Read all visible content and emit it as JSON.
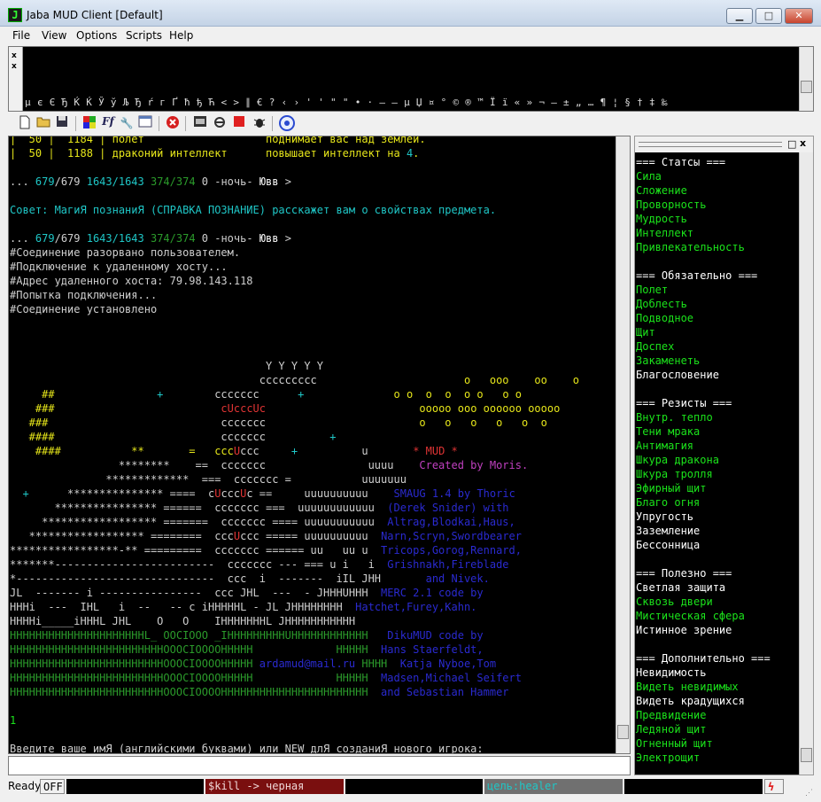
{
  "window": {
    "title": "Jaba MUD Client [Default]",
    "app_icon": "J",
    "minimize": "▁",
    "maximize": "□",
    "close": "✕"
  },
  "menu": [
    "File",
    "View",
    "Options",
    "Scripts",
    "Help"
  ],
  "char_panel": {
    "chars": "µ є Є Ђ Ќ Ќ Ў ў Љ Ђ ŕ г Ґ ħ ђ Ћ < > ∥ € ? ‹ › ' ' \" \" • · – — µ Џ ¤ ° © ® ™ Ї ї « » ¬ – ± „ … ¶ ¦ § † ‡ ‰",
    "gutter_top": "x",
    "gutter_bottom": "x"
  },
  "toolbar": {
    "icons": [
      "new-file-icon",
      "open-folder-icon",
      "save-icon",
      "color-palette-icon",
      "font-icon",
      "wrench-icon",
      "window-icon",
      "stop-record-icon",
      "map-icon",
      "disconnect-icon",
      "stop-icon",
      "bug-icon",
      "connect-icon"
    ]
  },
  "terminal": {
    "lines": [
      [
        [
          "|  50 |  1184 | полет                   поднимает вас над землей.",
          "y"
        ]
      ],
      [
        [
          "|  50 |  1188 | драконий интеллект      повышает интеллект на ",
          "y"
        ],
        [
          "4",
          "c"
        ],
        [
          ".",
          "y"
        ]
      ],
      [
        [
          "",
          "w"
        ]
      ],
      [
        [
          "... ",
          "w"
        ],
        [
          "679",
          "c"
        ],
        [
          "/679 ",
          "w"
        ],
        [
          "1643/1643",
          "c"
        ],
        [
          " ",
          "w"
        ],
        [
          "374/374",
          "dg"
        ],
        [
          " 0 -ночь- ",
          "w"
        ],
        [
          "Ювв",
          "bw"
        ],
        [
          " >",
          "w"
        ]
      ],
      [
        [
          "",
          "w"
        ]
      ],
      [
        [
          "Совет: МагиЯ познаниЯ (СПРАВКА ПОЗНАНИЕ) расскажет вам о свойствах предмета.",
          "c"
        ]
      ],
      [
        [
          "",
          "w"
        ]
      ],
      [
        [
          "... ",
          "w"
        ],
        [
          "679",
          "c"
        ],
        [
          "/679 ",
          "w"
        ],
        [
          "1643/1643",
          "c"
        ],
        [
          " ",
          "w"
        ],
        [
          "374/374",
          "dg"
        ],
        [
          " 0 -ночь- ",
          "w"
        ],
        [
          "Ювв",
          "bw"
        ],
        [
          " >",
          "w"
        ]
      ],
      [
        [
          "#Соединение разорвано пользователем.",
          "w"
        ]
      ],
      [
        [
          "#Подключение к удаленному хосту...",
          "w"
        ]
      ],
      [
        [
          "#Адрес удаленного хоста: 79.98.143.118",
          "w"
        ]
      ],
      [
        [
          "#Попытка подключения...",
          "w"
        ]
      ],
      [
        [
          "#Соединение установлено",
          "w"
        ]
      ],
      [
        [
          "",
          "w"
        ]
      ],
      [
        [
          "",
          "w"
        ]
      ],
      [
        [
          "",
          "w"
        ]
      ],
      [
        [
          "                                        Y Y Y Y Y",
          "w"
        ]
      ],
      [
        [
          "                                       ccccccccc                       ",
          "w"
        ],
        [
          "o   ooo    oo    o",
          "y"
        ]
      ],
      [
        [
          "     ##                ",
          "y"
        ],
        [
          "+",
          "c"
        ],
        [
          "        ccccccc      ",
          "w"
        ],
        [
          "+",
          "c"
        ],
        [
          "              ",
          "w"
        ],
        [
          "o o  o  o  o o   o o",
          "y"
        ]
      ],
      [
        [
          "    ###                          ",
          "y"
        ],
        [
          "cUcccUc",
          "r"
        ],
        [
          "                        ",
          "w"
        ],
        [
          "ooooo ooo oooooo ooooo",
          "y"
        ]
      ],
      [
        [
          "   ###                           ",
          "y"
        ],
        [
          "ccccccc",
          "w"
        ],
        [
          "                        ",
          "w"
        ],
        [
          "o   o   o   o   o  o",
          "y"
        ]
      ],
      [
        [
          "   ####                          ",
          "y"
        ],
        [
          "ccccccc",
          "w"
        ],
        [
          "          ",
          "w"
        ],
        [
          "+",
          "c"
        ]
      ],
      [
        [
          "    ####           **       =   ccc",
          "y"
        ],
        [
          "U",
          "r"
        ],
        [
          "ccc     ",
          "w"
        ],
        [
          "+",
          "c"
        ],
        [
          "          u       ",
          "w"
        ],
        [
          "* MUD *",
          "r"
        ]
      ],
      [
        [
          "                 ********    ==  ccccccc                uuuu    ",
          "w"
        ],
        [
          "Created by Moris.",
          "m"
        ]
      ],
      [
        [
          "               *************  ===  ccccccc =           uuuuuuu",
          "w"
        ]
      ],
      [
        [
          "  ",
          "w"
        ],
        [
          "+",
          "c"
        ],
        [
          "      *************** ====  c",
          "w"
        ],
        [
          "U",
          "r"
        ],
        [
          "ccc",
          "w"
        ],
        [
          "U",
          "r"
        ],
        [
          "c ==     uuuuuuuuuu    ",
          "w"
        ],
        [
          "SMAUG 1.4 by Thoric",
          "db"
        ]
      ],
      [
        [
          "       **************** ======  ccccccc ===  uuuuuuuuuuuu  ",
          "w"
        ],
        [
          "(Derek Snider) with",
          "db"
        ]
      ],
      [
        [
          "     ****************** =======  ccccccc ==== uuuuuuuuuuu  ",
          "w"
        ],
        [
          "Altrag,Blodkai,Haus,",
          "db"
        ]
      ],
      [
        [
          "   ****************** ========  ccc",
          "w"
        ],
        [
          "U",
          "r"
        ],
        [
          "ccc ===== uuuuuuuuuu  ",
          "w"
        ],
        [
          "Narn,Scryn,Swordbearer",
          "db"
        ]
      ],
      [
        [
          "*****************-** =========  ccccccc ====== uu   uu u  ",
          "w"
        ],
        [
          "Tricops,Gorog,Rennard,",
          "db"
        ]
      ],
      [
        [
          "*******-------------------------  ccccccc --- === u i   i  ",
          "w"
        ],
        [
          "Grishnakh,Fireblade",
          "db"
        ]
      ],
      [
        [
          "*-------------------------------  ccc  i  -------  iIL JHH       ",
          "w"
        ],
        [
          "and Nivek.",
          "db"
        ]
      ],
      [
        [
          "JL  ------- i ----------------  ccc JHL  ---  - JHHHUHHH  ",
          "w"
        ],
        [
          "MERC 2.1 code by",
          "db"
        ]
      ],
      [
        [
          "HHHi  ---  IHL   i  --   -- c iHHHHHL - JL JHHHHHHHH  ",
          "w"
        ],
        [
          "Hatchet,Furey,Kahn.",
          "db"
        ]
      ],
      [
        [
          "HHHHi_____iHHHL JHL    O   O    IHHHHHHHL JHHHHHHHHHHH",
          "w"
        ]
      ],
      [
        [
          "HHHHHHHHHHHHHHHHHHHHHL_ OOCIOOO _IHHHHHHHHHUHHHHHHHHHHHH   ",
          "dg"
        ],
        [
          "DikuMUD code by",
          "db"
        ]
      ],
      [
        [
          "HHHHHHHHHHHHHHHHHHHHHHHHOOOCIOOOOHHHHH             HHHHH  ",
          "dg"
        ],
        [
          "Hans Staerfeldt,",
          "db"
        ]
      ],
      [
        [
          "HHHHHHHHHHHHHHHHHHHHHHHHOOOCIOOOOHHHHH ",
          "dg"
        ],
        [
          "ardamud@mail.ru",
          "db"
        ],
        [
          " HHHH  ",
          "dg"
        ],
        [
          "Katja Nyboe,Tom",
          "db"
        ]
      ],
      [
        [
          "HHHHHHHHHHHHHHHHHHHHHHHHOOOCIOOOOHHHHH             HHHHH  ",
          "dg"
        ],
        [
          "Madsen,Michael Seifert",
          "db"
        ]
      ],
      [
        [
          "HHHHHHHHHHHHHHHHHHHHHHHHOOOCIOOOOHHHHHHHHHHHHHHHHHHHHHHH  ",
          "dg"
        ],
        [
          "and Sebastian Hammer",
          "db"
        ]
      ],
      [
        [
          "",
          "w"
        ]
      ],
      [
        [
          "1",
          "g"
        ]
      ],
      [
        [
          "",
          "w"
        ]
      ],
      [
        [
          "Введите ваше имЯ (английскими буквами) или NEW длЯ созданиЯ нового игрока:",
          "w"
        ]
      ]
    ]
  },
  "input": {
    "value": ""
  },
  "side_panel": {
    "lines": [
      [
        "=== Статсы ===",
        "bw"
      ],
      [
        "Сила",
        "g"
      ],
      [
        "Сложение",
        "g"
      ],
      [
        "Проворность",
        "g"
      ],
      [
        "Мудрость",
        "g"
      ],
      [
        "Интеллект",
        "g"
      ],
      [
        "Привлекательность",
        "g"
      ],
      [
        "",
        "w"
      ],
      [
        "=== Обязательно ===",
        "bw"
      ],
      [
        "Полет",
        "g"
      ],
      [
        "Доблесть",
        "g"
      ],
      [
        "Подводное",
        "g"
      ],
      [
        "Щит",
        "g"
      ],
      [
        "Доспех",
        "g"
      ],
      [
        "Закаменеть",
        "g"
      ],
      [
        "Благословение",
        "bw"
      ],
      [
        "",
        "w"
      ],
      [
        "=== Резисты ===",
        "bw"
      ],
      [
        "Внутр. тепло",
        "g"
      ],
      [
        "Тени мрака",
        "g"
      ],
      [
        "Антимагия",
        "g"
      ],
      [
        "Шкура дракона",
        "g"
      ],
      [
        "Шкура тролля",
        "g"
      ],
      [
        "Эфирный щит",
        "g"
      ],
      [
        "Благо огня",
        "g"
      ],
      [
        "Упругость",
        "bw"
      ],
      [
        "Заземление",
        "bw"
      ],
      [
        "Бессонница",
        "bw"
      ],
      [
        "",
        "w"
      ],
      [
        "=== Полезно ===",
        "bw"
      ],
      [
        "Светлая защита",
        "bw"
      ],
      [
        "Сквозь двери",
        "g"
      ],
      [
        "Мистическая сфера",
        "g"
      ],
      [
        "Истинное зрение",
        "bw"
      ],
      [
        "",
        "w"
      ],
      [
        "=== Дополнительно ===",
        "bw"
      ],
      [
        "Невидимость",
        "bw"
      ],
      [
        "Видеть невидимых",
        "g"
      ],
      [
        "Видеть крадущихся",
        "bw"
      ],
      [
        "Предвидение",
        "g"
      ],
      [
        "Ледяной щит",
        "g"
      ],
      [
        "Огненный щит",
        "g"
      ],
      [
        "Электрощит",
        "g"
      ]
    ],
    "pin": "□",
    "close": "x"
  },
  "status": {
    "ready": "Ready",
    "off": "OFF",
    "kill": "$kill -> черная",
    "target": "цель:healer",
    "lightning_icon": "lightning-icon"
  },
  "colors": {
    "green": "#1be31b",
    "cyan": "#1fc7c7",
    "yellow": "#e6e61a",
    "red": "#e03434",
    "blue": "#2a2ad0"
  }
}
